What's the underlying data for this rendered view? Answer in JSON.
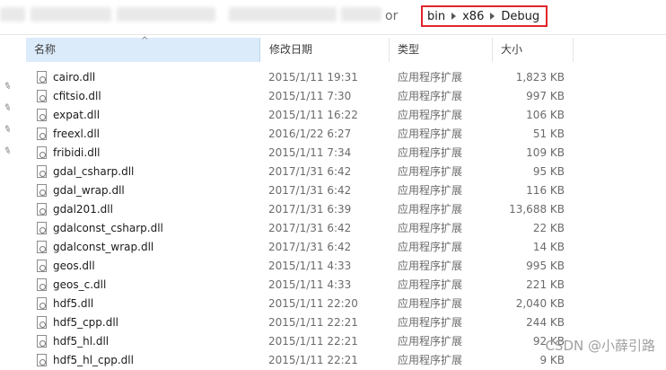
{
  "address": {
    "path_tail": "or",
    "crumbs": [
      "bin",
      "x86",
      "Debug"
    ]
  },
  "columns": {
    "name": "名称",
    "date": "修改日期",
    "type": "类型",
    "size": "大小"
  },
  "files": [
    {
      "name": "cairo.dll",
      "date": "2015/1/11 19:31",
      "type": "应用程序扩展",
      "size": "1,823 KB"
    },
    {
      "name": "cfitsio.dll",
      "date": "2015/1/11 7:30",
      "type": "应用程序扩展",
      "size": "997 KB"
    },
    {
      "name": "expat.dll",
      "date": "2015/1/11 16:22",
      "type": "应用程序扩展",
      "size": "106 KB"
    },
    {
      "name": "freexl.dll",
      "date": "2016/1/22 6:27",
      "type": "应用程序扩展",
      "size": "51 KB"
    },
    {
      "name": "fribidi.dll",
      "date": "2015/1/11 7:34",
      "type": "应用程序扩展",
      "size": "109 KB"
    },
    {
      "name": "gdal_csharp.dll",
      "date": "2017/1/31 6:42",
      "type": "应用程序扩展",
      "size": "95 KB"
    },
    {
      "name": "gdal_wrap.dll",
      "date": "2017/1/31 6:42",
      "type": "应用程序扩展",
      "size": "116 KB"
    },
    {
      "name": "gdal201.dll",
      "date": "2017/1/31 6:39",
      "type": "应用程序扩展",
      "size": "13,688 KB"
    },
    {
      "name": "gdalconst_csharp.dll",
      "date": "2017/1/31 6:42",
      "type": "应用程序扩展",
      "size": "22 KB"
    },
    {
      "name": "gdalconst_wrap.dll",
      "date": "2017/1/31 6:42",
      "type": "应用程序扩展",
      "size": "14 KB"
    },
    {
      "name": "geos.dll",
      "date": "2015/1/11 4:33",
      "type": "应用程序扩展",
      "size": "995 KB"
    },
    {
      "name": "geos_c.dll",
      "date": "2015/1/11 4:33",
      "type": "应用程序扩展",
      "size": "221 KB"
    },
    {
      "name": "hdf5.dll",
      "date": "2015/1/11 22:20",
      "type": "应用程序扩展",
      "size": "2,040 KB"
    },
    {
      "name": "hdf5_cpp.dll",
      "date": "2015/1/11 22:21",
      "type": "应用程序扩展",
      "size": "244 KB"
    },
    {
      "name": "hdf5_hl.dll",
      "date": "2015/1/11 22:21",
      "type": "应用程序扩展",
      "size": "92 KB"
    },
    {
      "name": "hdf5_hl_cpp.dll",
      "date": "2015/1/11 22:21",
      "type": "应用程序扩展",
      "size": "9 KB"
    }
  ],
  "watermark": "CSDN @小薛引路",
  "colors": {
    "highlight_border": "#e0262a",
    "header_selected_bg": "#dcebfa"
  }
}
